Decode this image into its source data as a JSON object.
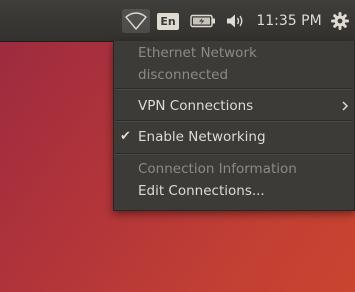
{
  "panel": {
    "keyboard_layout": "En",
    "clock": "11:35 PM",
    "icons": {
      "network": "wifi-icon",
      "battery": "battery-charging-icon",
      "sound": "speaker-volume-icon",
      "system": "gear-icon"
    }
  },
  "network_menu": {
    "ethernet_title": "Ethernet Network",
    "ethernet_status": "disconnected",
    "vpn_label": "VPN Connections",
    "enable_networking_label": "Enable Networking",
    "enable_networking_checked": true,
    "connection_info_label": "Connection Information",
    "edit_connections_label": "Edit Connections..."
  },
  "colors": {
    "panel_bg": "#3a3935",
    "menu_bg": "#3c3b37",
    "text": "#dfdbd2",
    "disabled_text": "#8b8a85",
    "desktop_gradient_start": "#9a2a3f",
    "desktop_gradient_end": "#c9452f"
  }
}
